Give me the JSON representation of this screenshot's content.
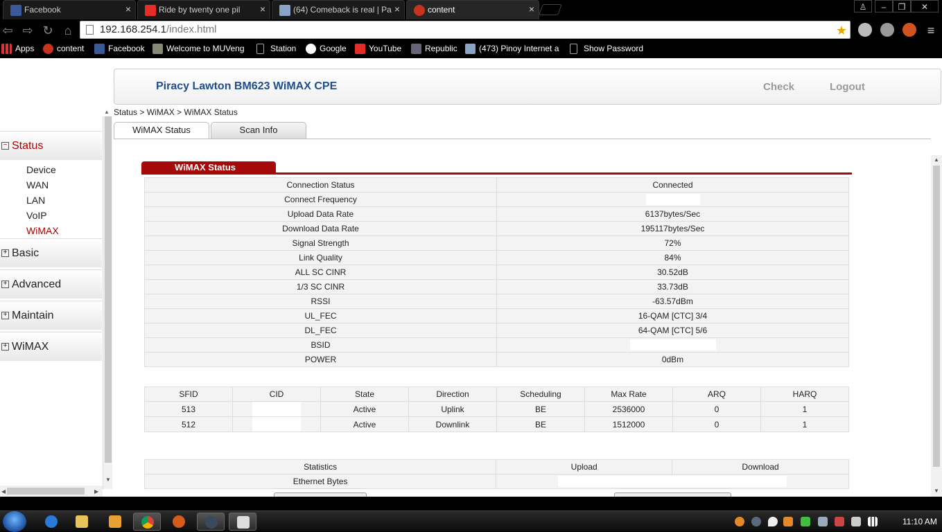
{
  "browser": {
    "tabs": [
      {
        "label": "Facebook"
      },
      {
        "label": "Ride by twenty one pil"
      },
      {
        "label": "(64) Comeback is real | Pa"
      },
      {
        "label": "content"
      }
    ],
    "address": {
      "host": "192.168.254.1",
      "path": "/index.html"
    },
    "bookmarks": [
      {
        "label": "Apps"
      },
      {
        "label": "content"
      },
      {
        "label": "Facebook"
      },
      {
        "label": "Welcome to MUVeng"
      },
      {
        "label": "Station"
      },
      {
        "label": "Google"
      },
      {
        "label": "YouTube"
      },
      {
        "label": "Republic"
      },
      {
        "label": "(473) Pinoy Internet a"
      },
      {
        "label": "Show Password"
      }
    ]
  },
  "header": {
    "title": "Piracy Lawton BM623 WiMAX CPE",
    "check": "Check",
    "logout": "Logout"
  },
  "breadcrumb": "Status > WiMAX > WiMAX Status",
  "menu": {
    "status": "Status",
    "status_items": [
      "Device",
      "WAN",
      "LAN",
      "VoIP",
      "WiMAX"
    ],
    "basic": "Basic",
    "advanced": "Advanced",
    "maintain": "Maintain",
    "wimax": "WiMAX",
    "open_symbol": "−",
    "closed_symbol": "+"
  },
  "tabs": {
    "wimax_status": "WiMAX Status",
    "scan_info": "Scan Info"
  },
  "section_title": "WiMAX Status",
  "status_rows": [
    {
      "key": "Connection Status",
      "value": "Connected"
    },
    {
      "key": "Connect Frequency",
      "value": ""
    },
    {
      "key": "Upload Data Rate",
      "value": "6137bytes/Sec"
    },
    {
      "key": "Download Data Rate",
      "value": "195117bytes/Sec"
    },
    {
      "key": "Signal Strength",
      "value": "72%"
    },
    {
      "key": "Link Quality",
      "value": "84%"
    },
    {
      "key": "ALL SC CINR",
      "value": "30.52dB"
    },
    {
      "key": "1/3 SC CINR",
      "value": "33.73dB"
    },
    {
      "key": "RSSI",
      "value": "-63.57dBm"
    },
    {
      "key": "UL_FEC",
      "value": "16-QAM [CTC] 3/4"
    },
    {
      "key": "DL_FEC",
      "value": "64-QAM [CTC] 5/6"
    },
    {
      "key": "BSID",
      "value": ""
    },
    {
      "key": "POWER",
      "value": "0dBm"
    }
  ],
  "flow_table": {
    "headers": [
      "SFID",
      "CID",
      "State",
      "Direction",
      "Scheduling",
      "Max Rate",
      "ARQ",
      "HARQ"
    ],
    "rows": [
      [
        "513",
        "",
        "Active",
        "Uplink",
        "BE",
        "2536000",
        "0",
        "1"
      ],
      [
        "512",
        "",
        "Active",
        "Downlink",
        "BE",
        "1512000",
        "0",
        "1"
      ]
    ]
  },
  "stats_table": {
    "headers": [
      "Statistics",
      "Upload",
      "Download"
    ],
    "row_label": "Ethernet Bytes"
  },
  "taskbar": {
    "clock": "11:10 AM"
  }
}
